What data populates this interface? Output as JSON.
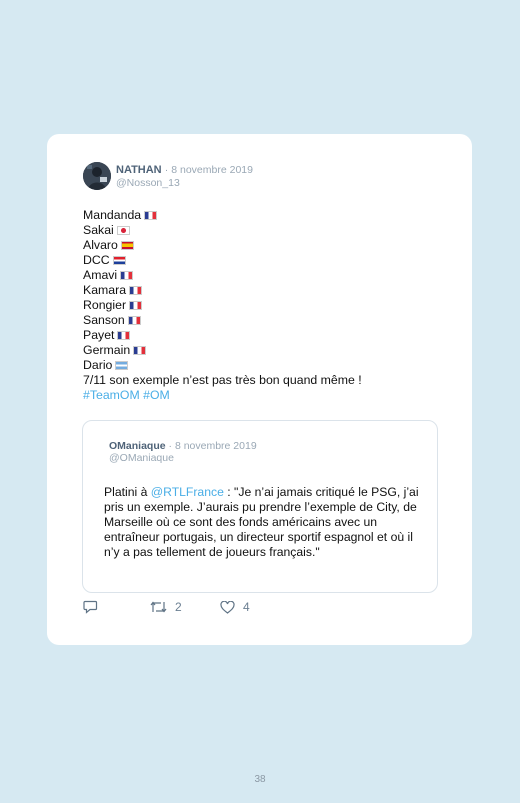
{
  "tweet": {
    "author_name": "NATHAN",
    "separator": "·",
    "date": "8 novembre 2019",
    "handle": "@Nosson_13",
    "players": [
      {
        "name": "Mandanda",
        "flag": "france-flag-icon"
      },
      {
        "name": "Sakai",
        "flag": "japan-flag-icon"
      },
      {
        "name": "Alvaro",
        "flag": "spain-flag-icon"
      },
      {
        "name": "DCC",
        "flag": "croatia-flag-icon"
      },
      {
        "name": "Amavi",
        "flag": "france-flag-icon"
      },
      {
        "name": "Kamara",
        "flag": "france-flag-icon"
      },
      {
        "name": "Rongier",
        "flag": "france-flag-icon"
      },
      {
        "name": "Sanson",
        "flag": "france-flag-icon"
      },
      {
        "name": "Payet",
        "flag": "france-flag-icon"
      },
      {
        "name": "Germain",
        "flag": "france-flag-icon"
      },
      {
        "name": "Dario",
        "flag": "argentina-flag-icon"
      }
    ],
    "closing_line": "7/11 son exemple n’est pas très bon quand même !",
    "hashtags": "#TeamOM #OM"
  },
  "quoted": {
    "author_name": "OManiaque",
    "separator": "·",
    "date": "8 novembre 2019",
    "handle": "@OManiaque",
    "text_prefix": "Platini à ",
    "mention": "@RTLFrance",
    "text_rest": " : \"Je n’ai jamais critiqué le PSG, j’ai pris un exemple. J’aurais pu prendre l’exemple de City, de Marseille où ce sont des fonds américains avec un entraîneur portugais, un directeur sportif espagnol et où il n’y a pas tellement de joueurs français.\""
  },
  "actions": {
    "retweet_count": "2",
    "like_count": "4"
  },
  "page": {
    "number": "38"
  },
  "colors": {
    "background": "#d6e9f2",
    "card": "#ffffff",
    "link": "#4aaee6",
    "name": "#4f6378",
    "meta": "#9aa8b5"
  }
}
